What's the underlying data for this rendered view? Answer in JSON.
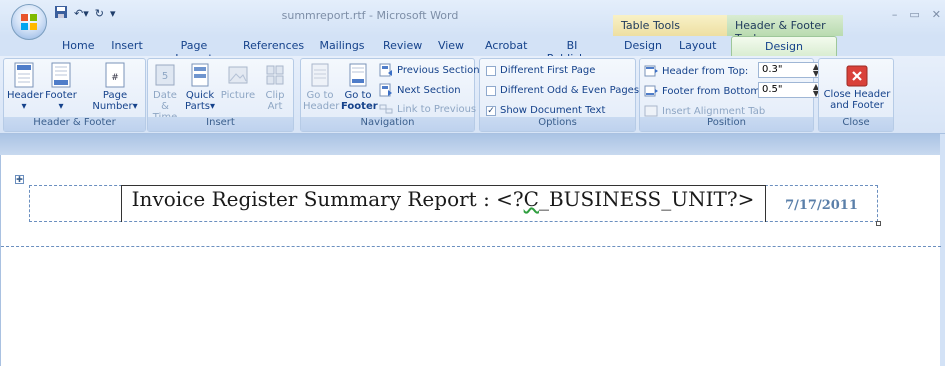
{
  "window": {
    "title": "summreport.rtf - Microsoft Word",
    "context_table": "Table Tools",
    "context_hf": "Header & Footer Tools"
  },
  "tabs": [
    "Home",
    "Insert",
    "Page Layout",
    "References",
    "Mailings",
    "Review",
    "View",
    "Acrobat",
    "BI Publisher",
    "Design",
    "Layout",
    "Design"
  ],
  "ribbon": {
    "header_footer": {
      "label": "Header & Footer",
      "header": "Header",
      "footer": "Footer",
      "page_number_1": "Page",
      "page_number_2": "Number"
    },
    "insert": {
      "label": "Insert",
      "date_1": "Date",
      "date_2": "& Time",
      "quick_1": "Quick",
      "quick_2": "Parts",
      "picture": "Picture",
      "clip_1": "Clip",
      "clip_2": "Art"
    },
    "navigation": {
      "label": "Navigation",
      "goto_header_1": "Go to",
      "goto_header_2": "Header",
      "goto_footer_1": "Go to",
      "goto_footer_2": "Footer",
      "previous_section": "Previous Section",
      "next_section": "Next Section",
      "link_previous": "Link to Previous"
    },
    "options": {
      "label": "Options",
      "different_first": "Different First Page",
      "different_odd_even": "Different Odd & Even Pages",
      "show_doc_text": "Show Document Text",
      "show_doc_text_checked": true
    },
    "position": {
      "label": "Position",
      "header_from_top": "Header from Top:",
      "header_value": "0.3\"",
      "footer_from_bottom": "Footer from Bottom:",
      "footer_value": "0.5\"",
      "insert_alignment_tab": "Insert Alignment Tab"
    },
    "close": {
      "label": "Close",
      "close_1": "Close Header",
      "close_2": "and Footer"
    }
  },
  "document": {
    "title_prefix": "Invoice Register Summary Report : <?",
    "title_field": "C",
    "title_suffix": "_BUSINESS_UNIT?>",
    "date": "7/17/2011"
  }
}
